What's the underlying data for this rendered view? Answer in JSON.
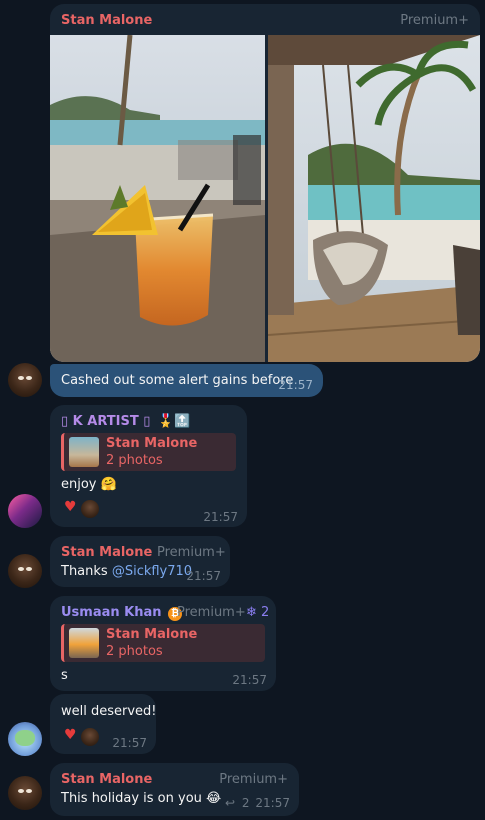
{
  "messages": {
    "m1": {
      "sender": "Stan Malone",
      "badge": "Premium+",
      "caption": "Cashed out some alert gains before",
      "time": "21:57"
    },
    "m2": {
      "sender": "▯ K ARTIST ▯",
      "badges": "🎖️🔝",
      "reply_name": "Stan Malone",
      "reply_snippet": "2 photos",
      "text": "enjoy 🤗",
      "reaction": "♥",
      "time": "21:57"
    },
    "m3": {
      "sender": "Stan Malone",
      "badge": "Premium+",
      "text": "Thanks ",
      "mention": "@Sickfly710",
      "time": "21:57"
    },
    "m4": {
      "sender": "Usmaan Khan",
      "sender_emoji": "₿",
      "badge": "Premium+",
      "rank": "❄ 2",
      "reply_name": "Stan Malone",
      "reply_snippet": "2 photos",
      "text": "s",
      "time": "21:57"
    },
    "m5": {
      "text": "well deserved!",
      "reaction": "♥",
      "time": "21:57"
    },
    "m6": {
      "sender": "Stan Malone",
      "badge": "Premium+",
      "text": "This holiday is on you 😂",
      "replies_icon": "↩",
      "replies_count": "2",
      "time": "21:57"
    }
  },
  "colors": {
    "background": "#0e1621",
    "bubble": "#182533",
    "bubble_highlight": "#2b5278",
    "sender_red": "#e86565",
    "sender_blue": "#7ba9ee"
  },
  "icons": {
    "reaction": "heart-icon",
    "thread": "reply-arrow-icon"
  }
}
